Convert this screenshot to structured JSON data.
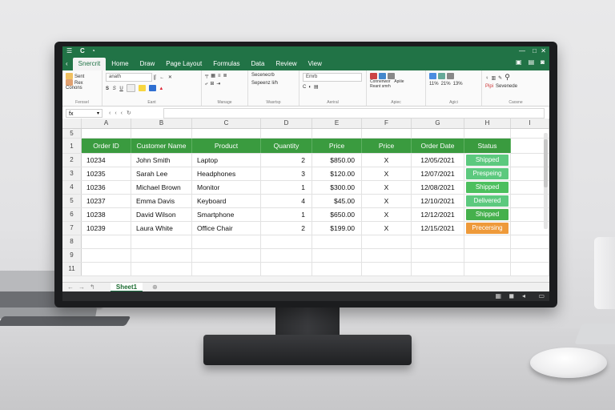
{
  "app": {
    "tabs": [
      {
        "label": "Snercrit",
        "active": true
      },
      {
        "label": "Home"
      },
      {
        "label": "Draw"
      },
      {
        "label": "Page Layout"
      },
      {
        "label": "Formulas"
      },
      {
        "label": "Data"
      },
      {
        "label": "Review"
      },
      {
        "label": "View"
      }
    ],
    "accent": "#217346",
    "header_fill": "#3a9b3f"
  },
  "ribbon": {
    "clipboard": {
      "paste1": "Sent",
      "paste2": "Rex",
      "paste3": "Conons",
      "label": "Ferosel"
    },
    "font": {
      "name": "anath",
      "bold": "S",
      "italic": "S",
      "underline": "U",
      "label": "Eant"
    },
    "align": {
      "label": "Manage"
    },
    "number": {
      "format1": "Secenecrb",
      "format2": "Sepeenz li/h",
      "label": "Wasrtsp"
    },
    "styles": {
      "format": "Emrb",
      "label": "Aeriral"
    },
    "cells": {
      "item1": "Connenwor",
      "item2": "Reant smrh",
      "item3": "Apiiie",
      "label": "Apiec"
    },
    "editing": {
      "v1": "11%",
      "v2": "21%",
      "v3": "13%",
      "label": "Agici"
    },
    "extra": {
      "item1": "Pipi",
      "item2": "Sevenede",
      "label": "Caosne"
    }
  },
  "formula_bar": {
    "name_box": "fx",
    "value": ""
  },
  "columns": [
    "A",
    "B",
    "C",
    "D",
    "E",
    "F",
    "G",
    "H",
    "I"
  ],
  "row_numbers": {
    "top": "5",
    "blank": [
      "8",
      "9",
      "11"
    ]
  },
  "sheet": {
    "headers": [
      "Order ID",
      "Customer Name",
      "Product",
      "Quantity",
      "Price",
      "Price",
      "Order Date",
      "Status"
    ],
    "rows": [
      {
        "num": "2",
        "id": "10234",
        "name": "John Smith",
        "product": "Laptop",
        "qty": "2",
        "price": "$850.00",
        "x": "X",
        "date": "12/05/2021",
        "status": "Shipped",
        "status_color": "#5cc97e"
      },
      {
        "num": "3",
        "id": "10235",
        "name": "Sarah Lee",
        "product": "Headphones",
        "qty": "3",
        "price": "$120.00",
        "x": "X",
        "date": "12/07/2021",
        "status": "Prespeing",
        "status_color": "#5cc97e"
      },
      {
        "num": "4",
        "id": "10236",
        "name": "Michael Brown",
        "product": "Monitor",
        "qty": "1",
        "price": "$300.00",
        "x": "X",
        "date": "12/08/2021",
        "status": "Shipped",
        "status_color": "#4cbf5e"
      },
      {
        "num": "5",
        "id": "10237",
        "name": "Emma Davis",
        "product": "Keyboard",
        "qty": "4",
        "price": "$45.00",
        "x": "X",
        "date": "12/10/2021",
        "status": "Delivered",
        "status_color": "#5cc97e"
      },
      {
        "num": "6",
        "id": "10238",
        "name": "David Wilson",
        "product": "Smartphone",
        "qty": "1",
        "price": "$650.00",
        "x": "X",
        "date": "12/12/2021",
        "status": "Shipped",
        "status_color": "#45b04c"
      },
      {
        "num": "7",
        "id": "10239",
        "name": "Laura White",
        "product": "Office Chair",
        "qty": "2",
        "price": "$199.00",
        "x": "X",
        "date": "12/15/2021",
        "status": "Precersing",
        "status_color": "#ee9a3a"
      }
    ],
    "header_row_num": "1"
  },
  "sheet_tabs": {
    "active": "Sheet1"
  }
}
